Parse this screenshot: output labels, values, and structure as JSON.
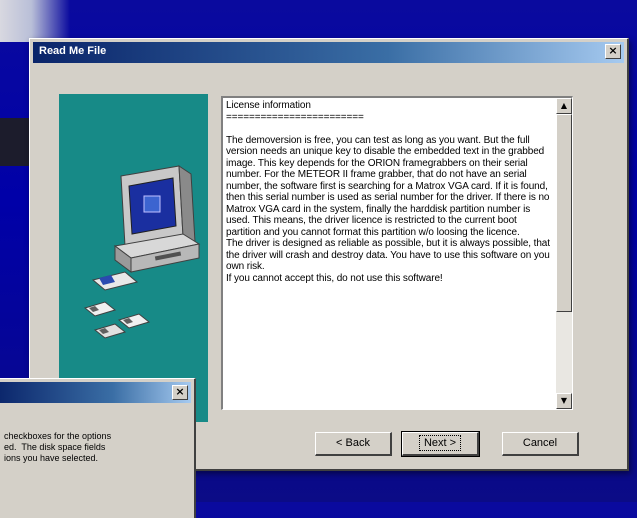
{
  "dialog": {
    "title": "Read Me File",
    "close_glyph": "×",
    "readme_text": "License information\n========================\n\nThe demoversion is free, you can test as long as you want. But the full version needs an unique key to disable the embedded text in the grabbed image. This key depends for the ORION framegrabbers on their serial number. For the METEOR II frame grabber, that do not have an serial number, the software first is searching for a Matrox VGA card. If it is found, then this serial number is used as serial number for the driver. If there is no Matrox VGA card in the system, finally the harddisk partition number is used. This means, the driver licence is restricted to the current boot partition and you cannot format this partition w/o loosing the licence.\nThe driver is designed as reliable as possible, but it is always possible, that the driver will crash and destroy data. You have to use this software on you own risk.\nIf you cannot accept this, do not use this software!",
    "scroll_up_glyph": "▲",
    "scroll_down_glyph": "▼",
    "buttons": {
      "back": "< Back",
      "next": "Next >",
      "cancel": "Cancel"
    },
    "illustration_icon": "computer-with-disks-icon",
    "illustration_color": "#178a87"
  },
  "background_dialog": {
    "close_glyph": "×",
    "text": "checkboxes for the options\ned.  The disk space fields\nions you have selected."
  },
  "colors": {
    "desktop": "#0000a8",
    "title_active": "#0a246a",
    "dialog_face": "#d4d0c8"
  }
}
